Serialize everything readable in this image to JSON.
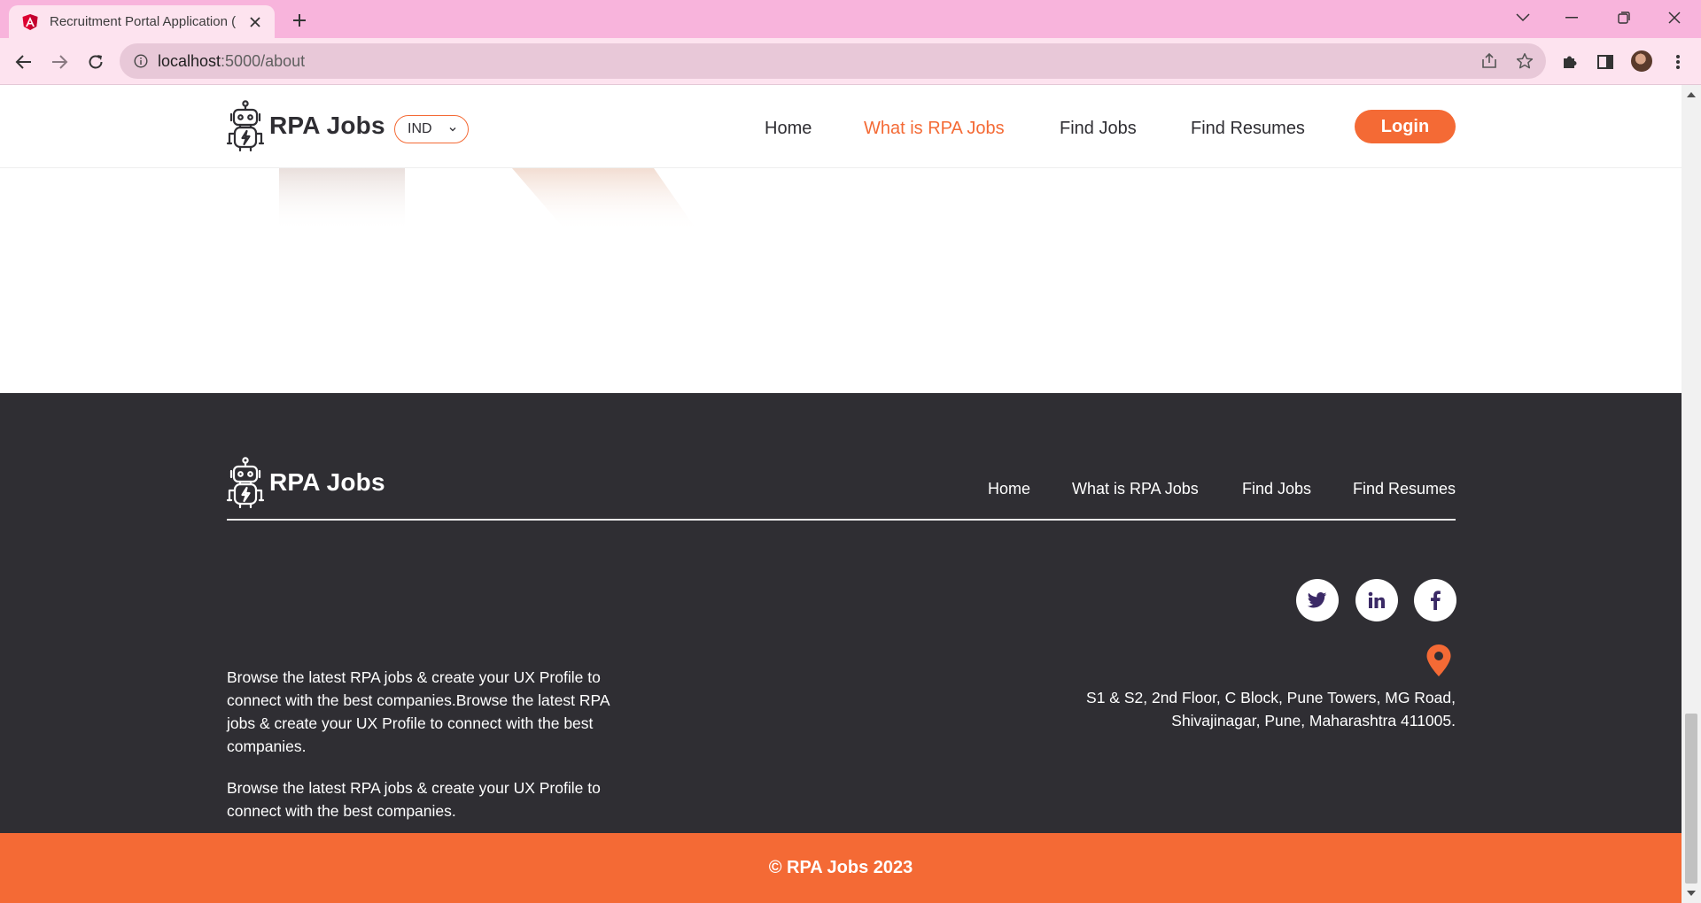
{
  "browser": {
    "tab_title": "Recruitment Portal Application (",
    "url_host": "localhost",
    "url_rest": ":5000/about",
    "icons": [
      "angular-favicon",
      "close-icon",
      "plus-icon",
      "chevron-down-icon",
      "minimize-icon",
      "restore-icon",
      "close-window-icon",
      "back-arrow-icon",
      "forward-arrow-icon",
      "reload-icon",
      "info-icon",
      "share-icon",
      "star-icon",
      "extensions-icon",
      "side-panel-icon",
      "kebab-menu-icon"
    ]
  },
  "header": {
    "brand": "RPA Jobs",
    "country": "IND",
    "nav": [
      "Home",
      "What is RPA Jobs",
      "Find Jobs",
      "Find Resumes"
    ],
    "active_nav": "What is RPA Jobs",
    "login_label": "Login"
  },
  "footer": {
    "brand": "RPA Jobs",
    "nav": [
      "Home",
      "What is RPA Jobs",
      "Find Jobs",
      "Find Resumes"
    ],
    "paragraph_1": "Browse the latest RPA jobs & create your UX Profile to connect with the best companies.Browse the latest RPA jobs & create your UX Profile to connect with the best companies.",
    "paragraph_2": "Browse the latest RPA jobs & create your UX Profile to connect with the best companies.",
    "social": [
      "twitter-icon",
      "linkedin-icon",
      "facebook-icon"
    ],
    "address_line_1": "S1 & S2, 2nd Floor, C Block, Pune Towers, MG Road,",
    "address_line_2": "Shivajinagar, Pune, Maharashtra 411005.",
    "copyright": "© RPA Jobs 2023"
  },
  "colors": {
    "accent": "#f46a35",
    "footer_bg": "#2f2e33",
    "social_icon": "#3b2a66",
    "tab_strip": "#f8b4dc",
    "toolbar": "#fde3ef"
  }
}
